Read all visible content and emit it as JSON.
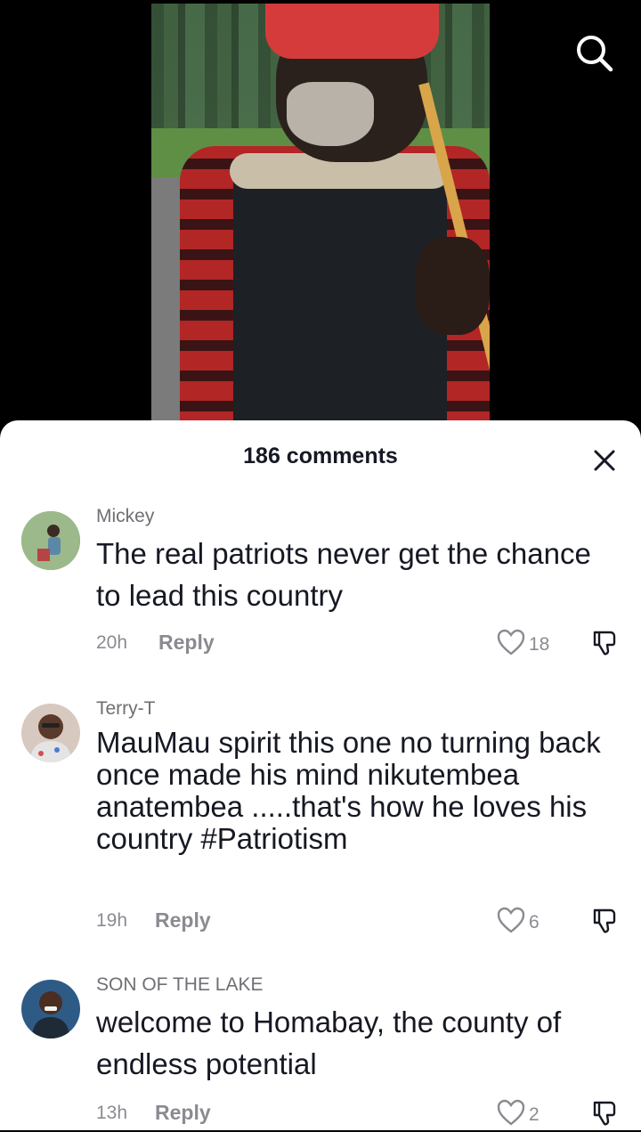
{
  "header": {
    "comment_count_label": "186 comments"
  },
  "comments": [
    {
      "username": "Mickey",
      "text": "The real patriots never get the chance to lead this country",
      "time": "20h",
      "reply_label": "Reply",
      "likes": "18"
    },
    {
      "username": "Terry-T",
      "text": "MauMau spirit this one no turning back once made his mind nikutembea anatembea .....that's how he loves his country #Patriotism",
      "time": "19h",
      "reply_label": "Reply",
      "likes": "6"
    },
    {
      "username": "SON OF THE LAKE",
      "text": "welcome to Homabay, the county of endless potential",
      "time": "13h",
      "reply_label": "Reply",
      "likes": "2"
    }
  ],
  "icons": {
    "search": "search-icon",
    "close": "close-icon",
    "like": "heart-icon",
    "dislike": "thumbs-down-icon"
  },
  "colors": {
    "sheet_bg": "#ffffff",
    "text_primary": "#161823",
    "text_secondary": "#8a8b91"
  }
}
